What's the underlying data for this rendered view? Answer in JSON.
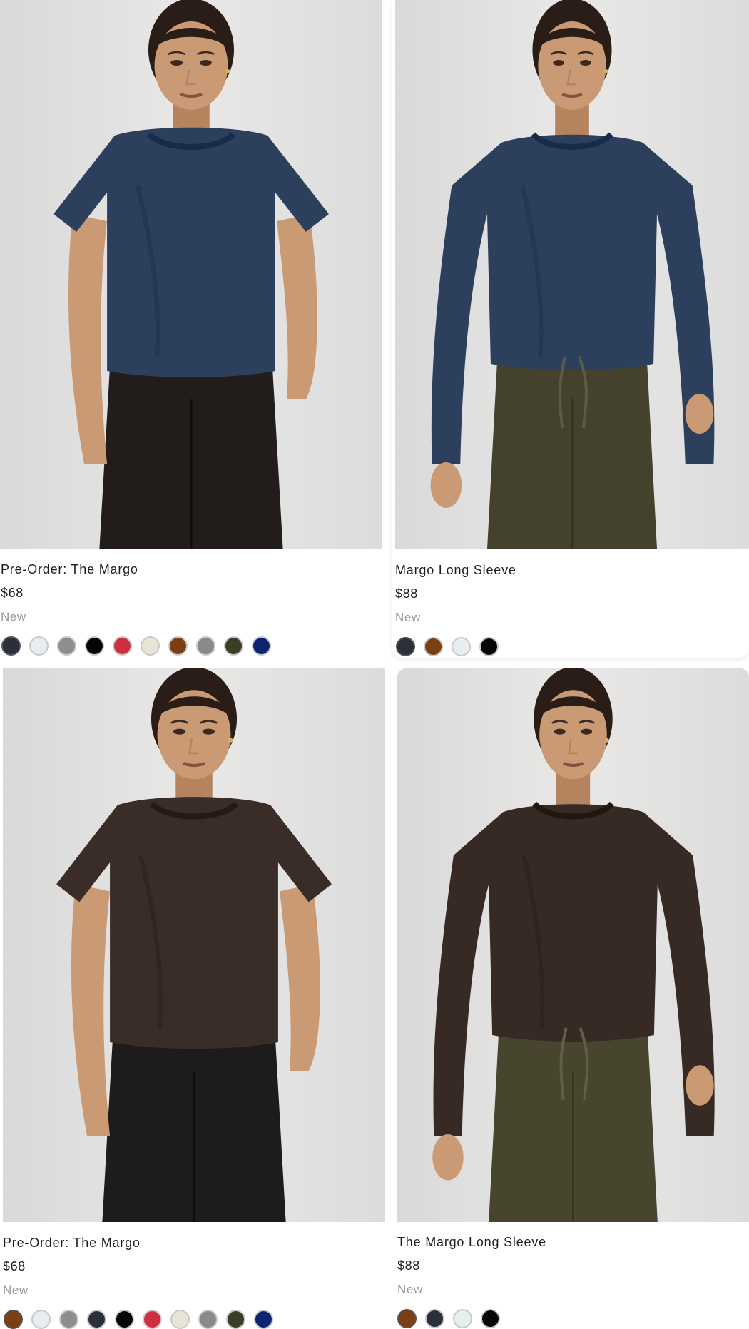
{
  "products": [
    {
      "name": "Pre-Order: The Margo",
      "price": "$68",
      "badge": "New",
      "garment": "tee",
      "shirt_color": "#2c3f5c",
      "pants_color": "#221c1b",
      "swatches": [
        {
          "name": "swatch-navy",
          "color": "#2b2f3c"
        },
        {
          "name": "swatch-light-blue",
          "color": "#e8edf0"
        },
        {
          "name": "swatch-heather-grey",
          "color": "#8e8e8e"
        },
        {
          "name": "swatch-black",
          "color": "#050505"
        },
        {
          "name": "swatch-red",
          "color": "#cf3040"
        },
        {
          "name": "swatch-cream",
          "color": "#e8e4d6"
        },
        {
          "name": "swatch-brown",
          "color": "#7b3f13"
        },
        {
          "name": "swatch-grey",
          "color": "#8a8a8a"
        },
        {
          "name": "swatch-olive",
          "color": "#3c3d27"
        },
        {
          "name": "swatch-royal-blue",
          "color": "#0e2470"
        }
      ]
    },
    {
      "name": "Margo Long Sleeve",
      "price": "$88",
      "badge": "New",
      "garment": "longsleeve",
      "shirt_color": "#2c3f5c",
      "pants_color": "#44412d",
      "swatches": [
        {
          "name": "swatch-navy",
          "color": "#2b2f3c"
        },
        {
          "name": "swatch-brown",
          "color": "#7b3f13"
        },
        {
          "name": "swatch-light-blue",
          "color": "#e8edf0"
        },
        {
          "name": "swatch-black",
          "color": "#050505"
        }
      ]
    },
    {
      "name": "Pre-Order: The Margo",
      "price": "$68",
      "badge": "New",
      "garment": "tee",
      "shirt_color": "#3a2c26",
      "pants_color": "#1d1b1c",
      "swatches": [
        {
          "name": "swatch-brown",
          "color": "#7b3f13"
        },
        {
          "name": "swatch-light-blue",
          "color": "#e8edf0"
        },
        {
          "name": "swatch-heather-grey",
          "color": "#8e8e8e"
        },
        {
          "name": "swatch-navy",
          "color": "#2b2f3c"
        },
        {
          "name": "swatch-black",
          "color": "#050505"
        },
        {
          "name": "swatch-red",
          "color": "#cf3040"
        },
        {
          "name": "swatch-cream",
          "color": "#e8e4d6"
        },
        {
          "name": "swatch-grey",
          "color": "#8a8a8a"
        },
        {
          "name": "swatch-olive",
          "color": "#3c3d27"
        },
        {
          "name": "swatch-royal-blue",
          "color": "#0e2470"
        }
      ]
    },
    {
      "name": "The Margo Long Sleeve",
      "price": "$88",
      "badge": "New",
      "garment": "longsleeve",
      "shirt_color": "#372a25",
      "pants_color": "#47452e",
      "swatches": [
        {
          "name": "swatch-brown",
          "color": "#7b3f13"
        },
        {
          "name": "swatch-navy",
          "color": "#2b2f3c"
        },
        {
          "name": "swatch-light-blue",
          "color": "#e8edf0"
        },
        {
          "name": "swatch-black",
          "color": "#050505"
        }
      ]
    }
  ]
}
